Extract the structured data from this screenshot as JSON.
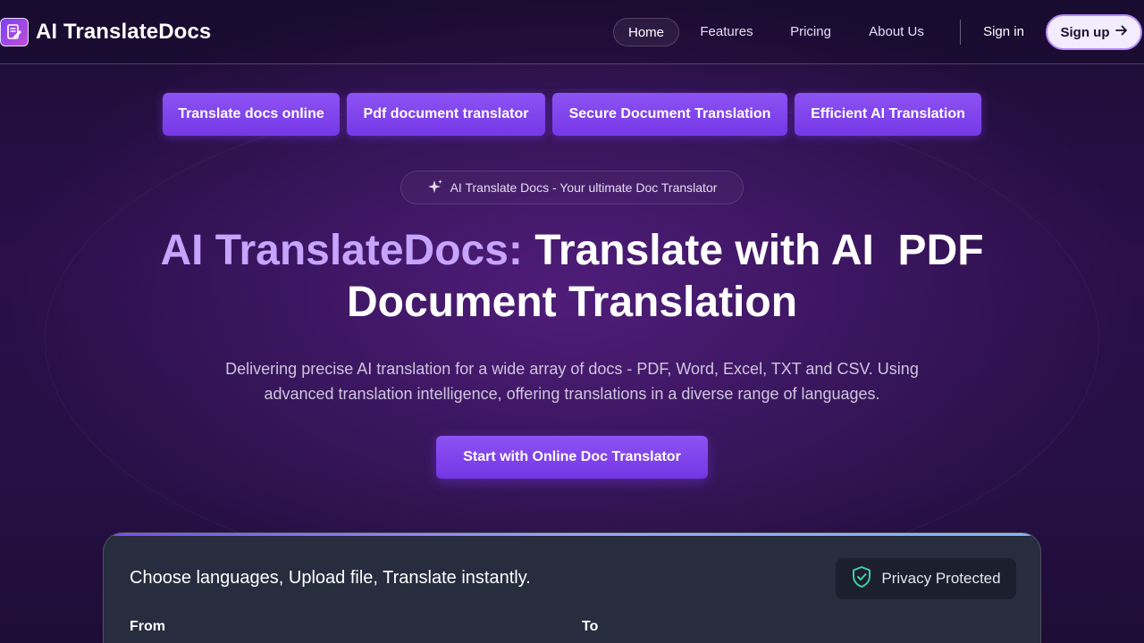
{
  "nav": {
    "brand": "AI TranslateDocs",
    "links": [
      "Home",
      "Features",
      "Pricing",
      "About Us"
    ],
    "sign_in": "Sign in",
    "sign_up": "Sign up"
  },
  "tags": [
    "Translate docs online",
    "Pdf document translator",
    "Secure Document Translation",
    "Efficient AI Translation"
  ],
  "badge": "AI Translate Docs - Your ultimate Doc Translator",
  "hero": {
    "title_accent": "AI TranslateDocs:",
    "title_line1": " Translate with AI  PDF",
    "title_line2": "Document Translation",
    "subtitle_line1": "Delivering precise AI translation for a wide array of docs - PDF, Word, Excel, TXT and CSV. Using",
    "subtitle_line2": "advanced translation intelligence, offering translations in a diverse range of languages.",
    "cta": "Start with Online Doc Translator"
  },
  "card": {
    "title": "Choose languages, Upload file, Translate instantly.",
    "privacy": "Privacy Protected",
    "from_label": "From",
    "to_label": "To"
  },
  "colors": {
    "accent": "#8d52f3",
    "title_accent": "#c6a4ff",
    "background": "#2a0f4a",
    "card": "#282c3f"
  },
  "icons": [
    "document-edit-icon",
    "arrow-right-icon",
    "sparkle-icon",
    "shield-check-icon"
  ]
}
